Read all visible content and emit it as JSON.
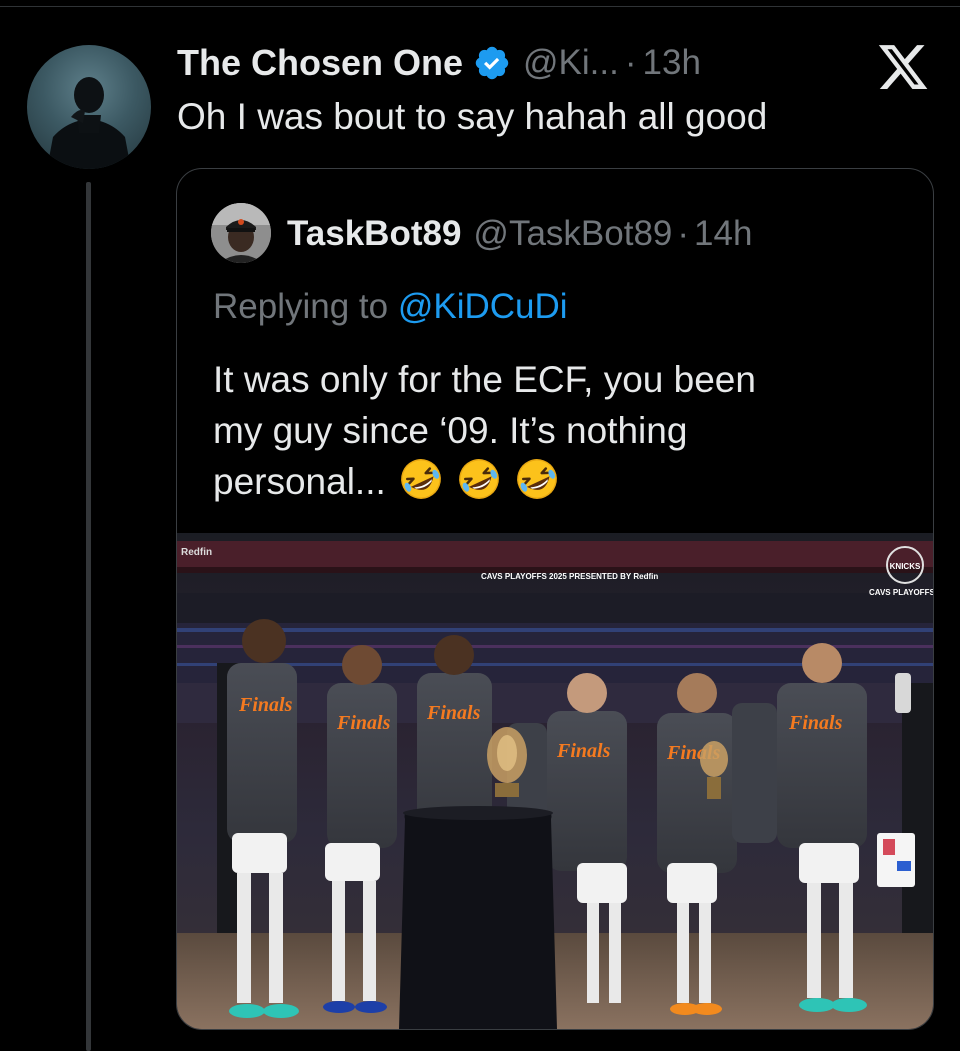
{
  "tweet": {
    "display_name": "The Chosen One",
    "handle": "@Ki...",
    "dot": "·",
    "time": "13h",
    "text": "Oh I was bout to say hahah all good",
    "verified": true
  },
  "quote": {
    "display_name": "TaskBot89",
    "handle": "@TaskBot89",
    "dot": "·",
    "time": "14h",
    "replying_prefix": "Replying to",
    "replying_mention": "@KiDCuDi",
    "text_lines": [
      "It was only for the ECF, you been",
      "my guy since ‘09. It’s nothing",
      "personal..."
    ],
    "emoji": [
      "rolling-on-floor-laughing",
      "rolling-on-floor-laughing",
      "rolling-on-floor-laughing"
    ],
    "photo": {
      "banner_left": "Redfin",
      "banner_mid": "CAVS PLAYOFFS 2025 PRESENTED BY Redfin",
      "banner_right": "CAVS PLAYOFFS",
      "logo": "KNICKS",
      "shirt_text": "Finals"
    }
  },
  "colors": {
    "background": "#000000",
    "text": "#e7e9ea",
    "muted": "#71767b",
    "link": "#1d9bf0",
    "verified": "#1d9bf0",
    "border": "#3a3e42"
  },
  "icons": {
    "verified": "verified-badge-icon",
    "brand": "x-logo-icon"
  }
}
